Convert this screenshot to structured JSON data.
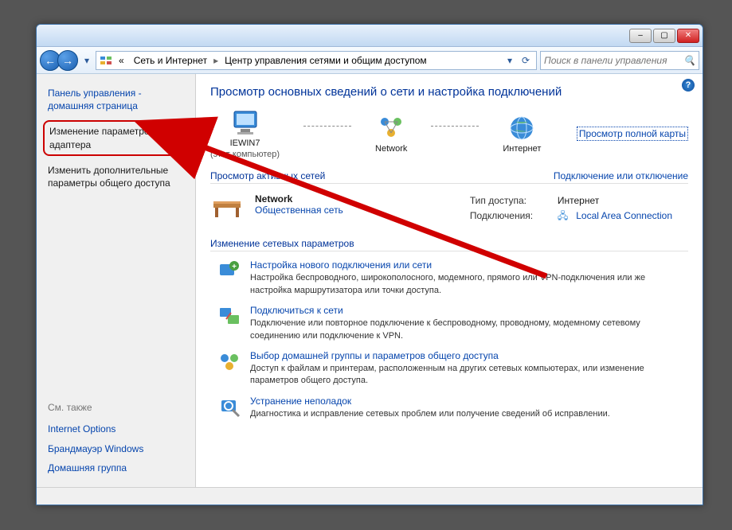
{
  "title_buttons": {
    "minimize": "–",
    "maximize": "▢",
    "close": "✕"
  },
  "nav": {
    "back_icon": "←",
    "forward_icon": "→",
    "dropdown_icon": "▾",
    "refresh_icon": "⟳"
  },
  "address": {
    "root_prefix": "«",
    "seg1": "Сеть и Интернет",
    "seg2": "Центр управления сетями и общим доступом",
    "sep": "▸"
  },
  "search": {
    "placeholder": "Поиск в панели управления",
    "icon": "🔍"
  },
  "help_icon": "?",
  "sidebar": {
    "home": "Панель управления - домашняя страница",
    "adapter": "Изменение параметров адаптера",
    "sharing": "Изменить дополнительные параметры общего доступа",
    "see_also": "См. также",
    "links": [
      "Internet Options",
      "Брандмауэр Windows",
      "Домашняя группа"
    ]
  },
  "main": {
    "heading": "Просмотр основных сведений о сети и настройка подключений",
    "full_map": "Просмотр полной карты",
    "nodes": {
      "pc": "IEWIN7",
      "pc_sub": "(этот компьютер)",
      "net": "Network",
      "internet": "Интернет"
    },
    "active_nets_title": "Просмотр активных сетей",
    "connect_link": "Подключение или отключение",
    "network": {
      "name": "Network",
      "type": "Общественная сеть",
      "access_lbl": "Тип доступа:",
      "access_val": "Интернет",
      "conn_lbl": "Подключения:",
      "conn_val": "Local Area Connection"
    },
    "settings_title": "Изменение сетевых параметров",
    "items": [
      {
        "title": "Настройка нового подключения или сети",
        "desc": "Настройка беспроводного, широкополосного, модемного, прямого или VPN-подключения или же настройка маршрутизатора или точки доступа."
      },
      {
        "title": "Подключиться к сети",
        "desc": "Подключение или повторное подключение к беспроводному, проводному, модемному сетевому соединению или подключение к VPN."
      },
      {
        "title": "Выбор домашней группы и параметров общего доступа",
        "desc": "Доступ к файлам и принтерам, расположенным на других сетевых компьютерах, или изменение параметров общего доступа."
      },
      {
        "title": "Устранение неполадок",
        "desc": "Диагностика и исправление сетевых проблем или получение сведений об исправлении."
      }
    ]
  }
}
